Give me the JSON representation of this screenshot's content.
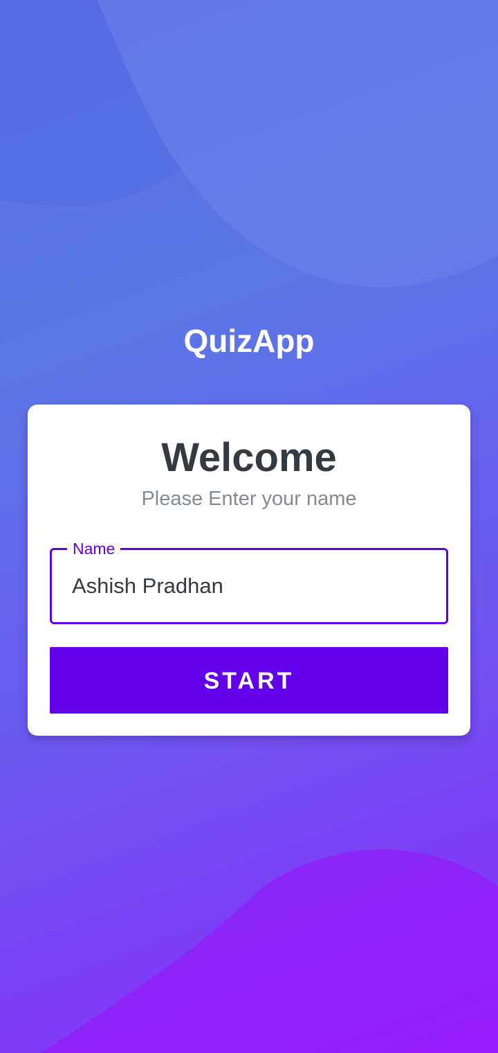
{
  "app": {
    "title": "QuizApp"
  },
  "card": {
    "heading": "Welcome",
    "subtitle": "Please Enter your name"
  },
  "name_field": {
    "label": "Name",
    "value": "Ashish Pradhan"
  },
  "start_button": {
    "label": "START"
  },
  "colors": {
    "accent": "#6200ea",
    "background_top": "#5a6fe6",
    "background_bottom": "#8a2af8",
    "heading_text": "#353a41",
    "subtitle_text": "#838a91"
  }
}
